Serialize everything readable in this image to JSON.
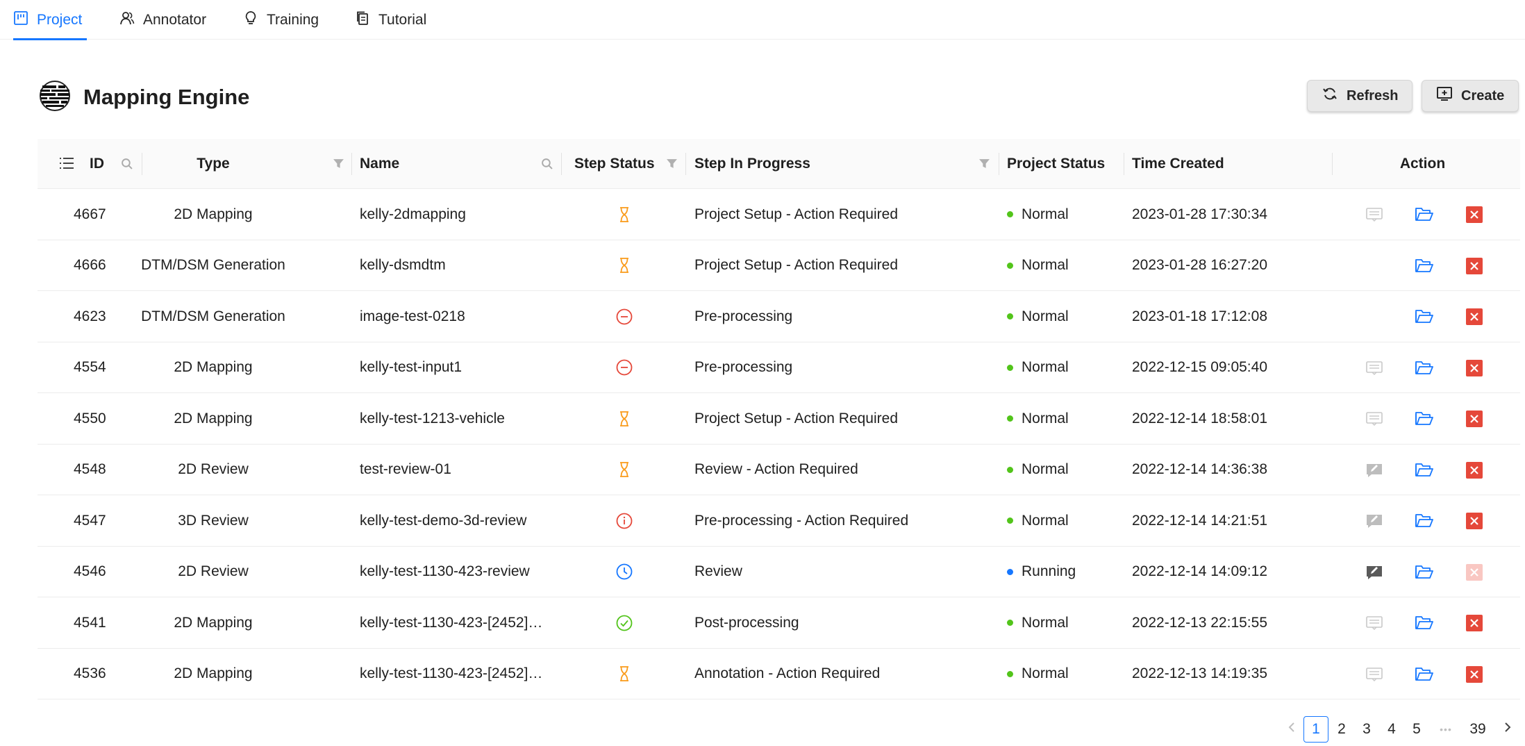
{
  "nav": {
    "tabs": [
      {
        "label": "Project",
        "icon": "project-board-icon",
        "active": true
      },
      {
        "label": "Annotator",
        "icon": "annotator-people-icon",
        "active": false
      },
      {
        "label": "Training",
        "icon": "training-bulb-icon",
        "active": false
      },
      {
        "label": "Tutorial",
        "icon": "tutorial-copy-icon",
        "active": false
      }
    ]
  },
  "header": {
    "title": "Mapping Engine",
    "logo_icon": "globe-logo-icon",
    "refresh_label": "Refresh",
    "create_label": "Create"
  },
  "table": {
    "columns": {
      "id": "ID",
      "type": "Type",
      "name": "Name",
      "step_status": "Step Status",
      "step_in_progress": "Step In Progress",
      "project_status": "Project Status",
      "time_created": "Time Created",
      "action": "Action"
    },
    "rows": [
      {
        "id": "4667",
        "type": "2D Mapping",
        "name": "kelly-2dmapping",
        "step_status": "waiting",
        "step": "Project Setup - Action Required",
        "status": "Normal",
        "status_color": "#52c41a",
        "time": "2023-01-28 17:30:34",
        "note": "message",
        "delete_enabled": true
      },
      {
        "id": "4666",
        "type": "DTM/DSM Generation",
        "name": "kelly-dsmdtm",
        "step_status": "waiting",
        "step": "Project Setup - Action Required",
        "status": "Normal",
        "status_color": "#52c41a",
        "time": "2023-01-28 16:27:20",
        "note": "none",
        "delete_enabled": true
      },
      {
        "id": "4623",
        "type": "DTM/DSM Generation",
        "name": "image-test-0218",
        "step_status": "failed",
        "step": "Pre-processing",
        "status": "Normal",
        "status_color": "#52c41a",
        "time": "2023-01-18 17:12:08",
        "note": "none",
        "delete_enabled": true
      },
      {
        "id": "4554",
        "type": "2D Mapping",
        "name": "kelly-test-input1",
        "step_status": "failed",
        "step": "Pre-processing",
        "status": "Normal",
        "status_color": "#52c41a",
        "time": "2022-12-15 09:05:40",
        "note": "message",
        "delete_enabled": true
      },
      {
        "id": "4550",
        "type": "2D Mapping",
        "name": "kelly-test-1213-vehicle",
        "step_status": "waiting",
        "step": "Project Setup - Action Required",
        "status": "Normal",
        "status_color": "#52c41a",
        "time": "2022-12-14 18:58:01",
        "note": "message",
        "delete_enabled": true
      },
      {
        "id": "4548",
        "type": "2D Review",
        "name": "test-review-01",
        "step_status": "waiting",
        "step": "Review - Action Required",
        "status": "Normal",
        "status_color": "#52c41a",
        "time": "2022-12-14 14:36:38",
        "note": "review",
        "delete_enabled": true
      },
      {
        "id": "4547",
        "type": "3D Review",
        "name": "kelly-test-demo-3d-review",
        "step_status": "info",
        "step": "Pre-processing - Action Required",
        "status": "Normal",
        "status_color": "#52c41a",
        "time": "2022-12-14 14:21:51",
        "note": "review",
        "delete_enabled": true
      },
      {
        "id": "4546",
        "type": "2D Review",
        "name": "kelly-test-1130-423-review",
        "step_status": "running",
        "step": "Review",
        "status": "Running",
        "status_color": "#1677ff",
        "time": "2022-12-14 14:09:12",
        "note": "review-dark",
        "delete_enabled": false
      },
      {
        "id": "4541",
        "type": "2D Mapping",
        "name": "kelly-test-1130-423-[2452]…",
        "step_status": "done",
        "step": "Post-processing",
        "status": "Normal",
        "status_color": "#52c41a",
        "time": "2022-12-13 22:15:55",
        "note": "message",
        "delete_enabled": true
      },
      {
        "id": "4536",
        "type": "2D Mapping",
        "name": "kelly-test-1130-423-[2452]…",
        "step_status": "waiting",
        "step": "Annotation - Action Required",
        "status": "Normal",
        "status_color": "#52c41a",
        "time": "2022-12-13 14:19:35",
        "note": "message",
        "delete_enabled": true
      }
    ]
  },
  "pagination": {
    "pages": [
      "1",
      "2",
      "3",
      "4",
      "5"
    ],
    "ellipsis": "•••",
    "last": "39",
    "current": "1"
  },
  "colors": {
    "accent": "#1677ff",
    "waiting": "#fa9b1a",
    "failed": "#e5483a",
    "done": "#52c41a",
    "delete": "#e5483a"
  }
}
